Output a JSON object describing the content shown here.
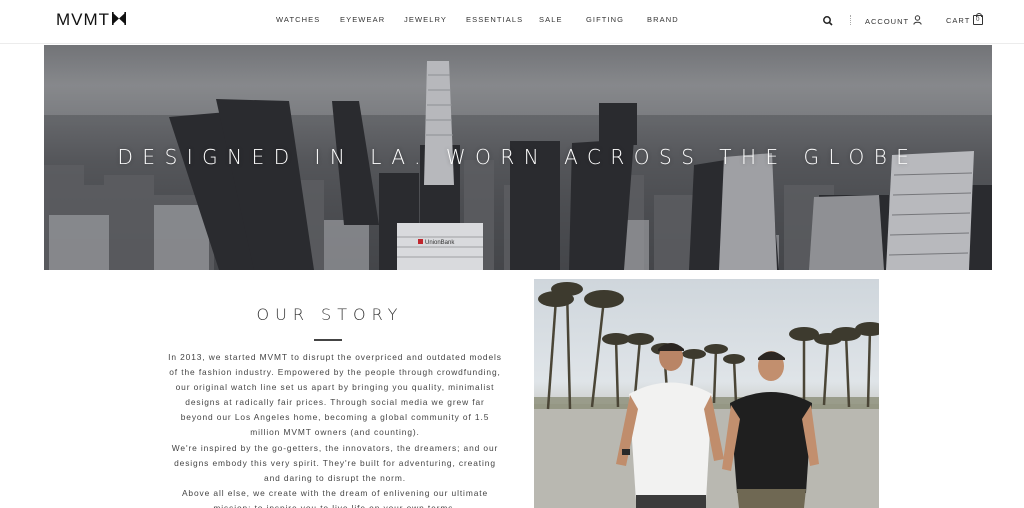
{
  "brand": {
    "logo_text": "MVMT"
  },
  "nav": {
    "items": [
      {
        "label": "WATCHES"
      },
      {
        "label": "EYEWEAR"
      },
      {
        "label": "JEWELRY"
      },
      {
        "label": "ESSENTIALS"
      },
      {
        "label": "SALE"
      },
      {
        "label": "GIFTING"
      },
      {
        "label": "BRAND"
      }
    ],
    "account_label": "ACCOUNT",
    "cart_label": "CART",
    "cart_count": "0"
  },
  "hero": {
    "headline": "DESIGNED IN LA. WORN ACROSS THE GLOBE",
    "sign_text": "UnionBank"
  },
  "story": {
    "title": "OUR STORY",
    "paragraphs": [
      "In 2013, we started MVMT to disrupt the overpriced and outdated models of the fashion industry. Empowered by the people through crowdfunding, our original watch line set us apart by bringing you quality, minimalist designs at radically fair prices. Through social media we grew far beyond our Los Angeles home, becoming a global community of 1.5 million MVMT owners (and counting).",
      "We're inspired by the go-getters, the innovators, the dreamers; and our designs embody this very spirit. They're built for adventuring, creating and daring to disrupt the norm.",
      "Above all else, we create with the dream of enlivening our ultimate mission: to inspire you to live life on your own terms."
    ]
  },
  "icons": {
    "search": "search-icon",
    "account": "user-icon",
    "cart": "shopping-bag-icon"
  }
}
